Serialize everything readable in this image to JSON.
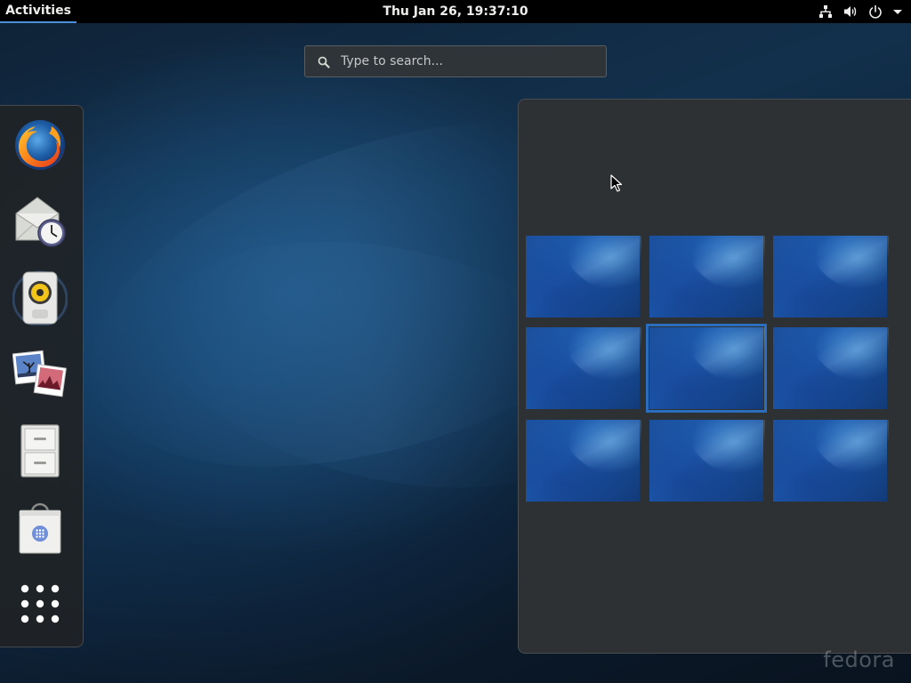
{
  "topbar": {
    "activities_label": "Activities",
    "clock": "Thu Jan 26, 19:37:10",
    "icons": [
      "network-wired-icon",
      "volume-icon",
      "power-icon",
      "chevron-down-icon"
    ]
  },
  "search": {
    "placeholder": "Type to search..."
  },
  "dash": {
    "items": [
      {
        "name": "firefox-icon"
      },
      {
        "name": "evolution-icon"
      },
      {
        "name": "rhythmbox-icon"
      },
      {
        "name": "shotwell-icon"
      },
      {
        "name": "files-icon"
      },
      {
        "name": "software-icon"
      },
      {
        "name": "show-applications-icon"
      }
    ]
  },
  "workspaces": {
    "count": 9,
    "active_index": 4
  },
  "colors": {
    "accent": "#4a90d9",
    "topbar": "#000000",
    "panel": "#2e3133"
  },
  "watermark": "fedora"
}
